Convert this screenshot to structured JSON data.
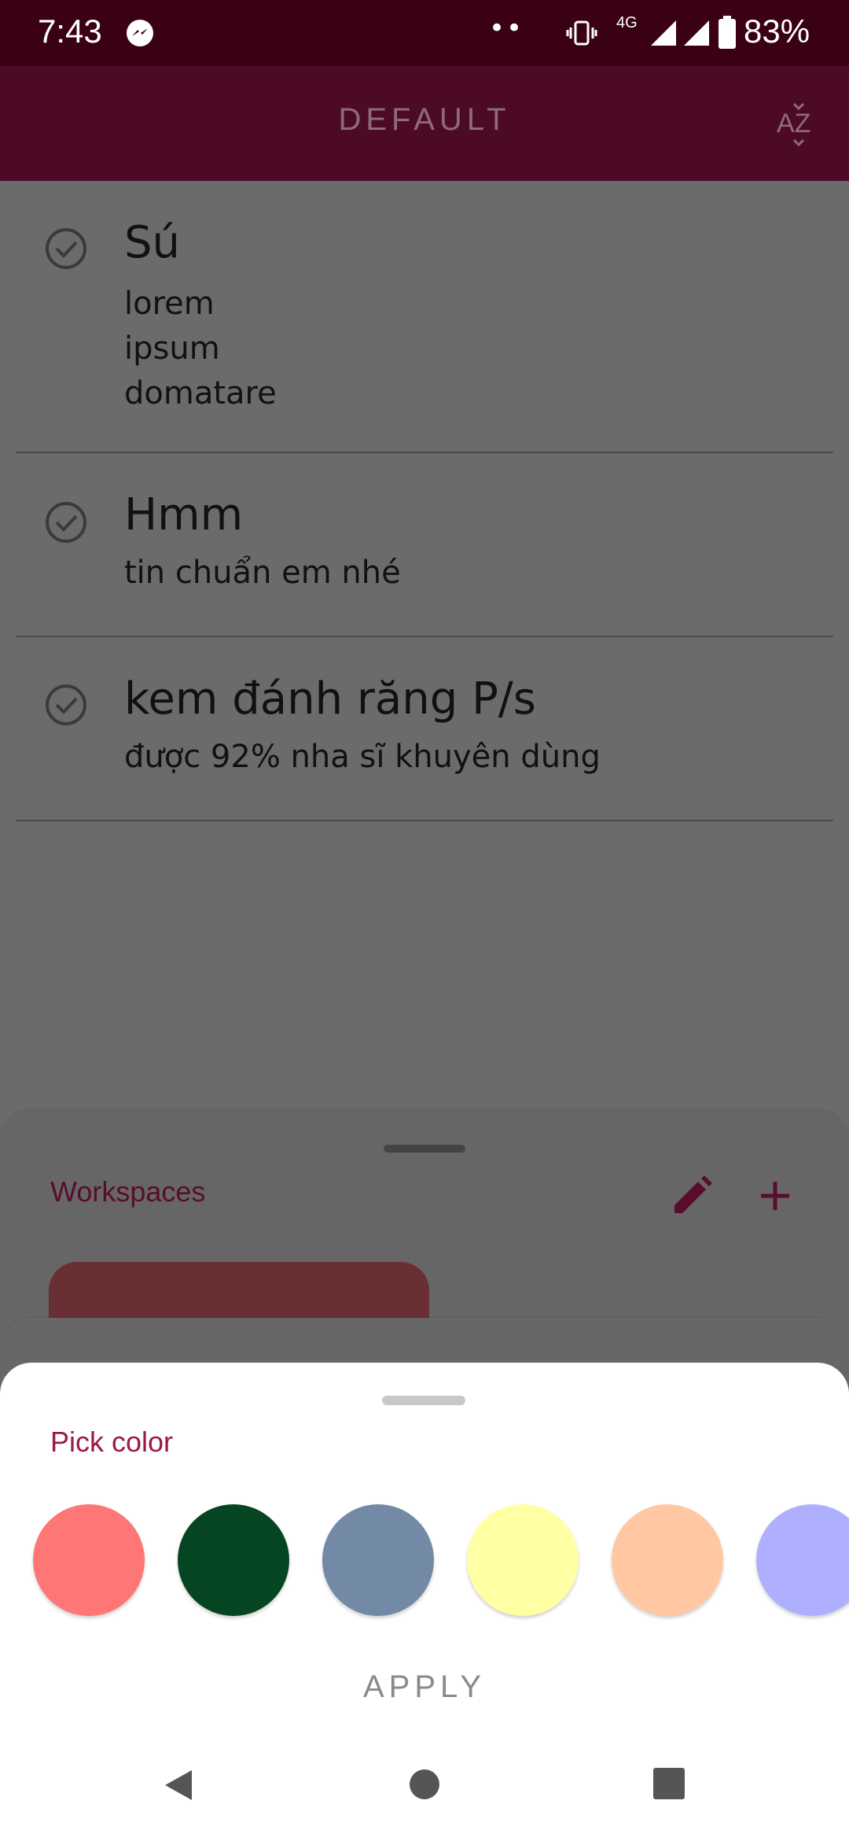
{
  "status_bar": {
    "time": "7:43",
    "dots": "••",
    "network": "4G",
    "battery": "83%",
    "icons": [
      "messenger-icon",
      "vibrate-icon",
      "signal-icon",
      "battery-icon"
    ]
  },
  "app_bar": {
    "title": "DEFAULT",
    "sort_icon_text": "AZ"
  },
  "notes": [
    {
      "title": "Sú",
      "description": "lorem\nipsum\ndomatare"
    },
    {
      "title": "Hmm",
      "description": "tin chuẩn em nhé"
    },
    {
      "title": "kem đánh răng P/s",
      "description": "được 92% nha sĩ khuyên dùng"
    }
  ],
  "workspaces": {
    "title": "Workspaces",
    "accent_color": "#6b3033"
  },
  "pick_color": {
    "title": "Pick color",
    "apply_label": "APPLY",
    "swatches": [
      "#ff7676",
      "#064521",
      "#728aa6",
      "#ffffa4",
      "#ffc8a3",
      "#aeb0ff"
    ]
  },
  "colors": {
    "status_bar": "#3a0016",
    "app_bar": "#4c0a26",
    "accent": "#9c1848"
  }
}
